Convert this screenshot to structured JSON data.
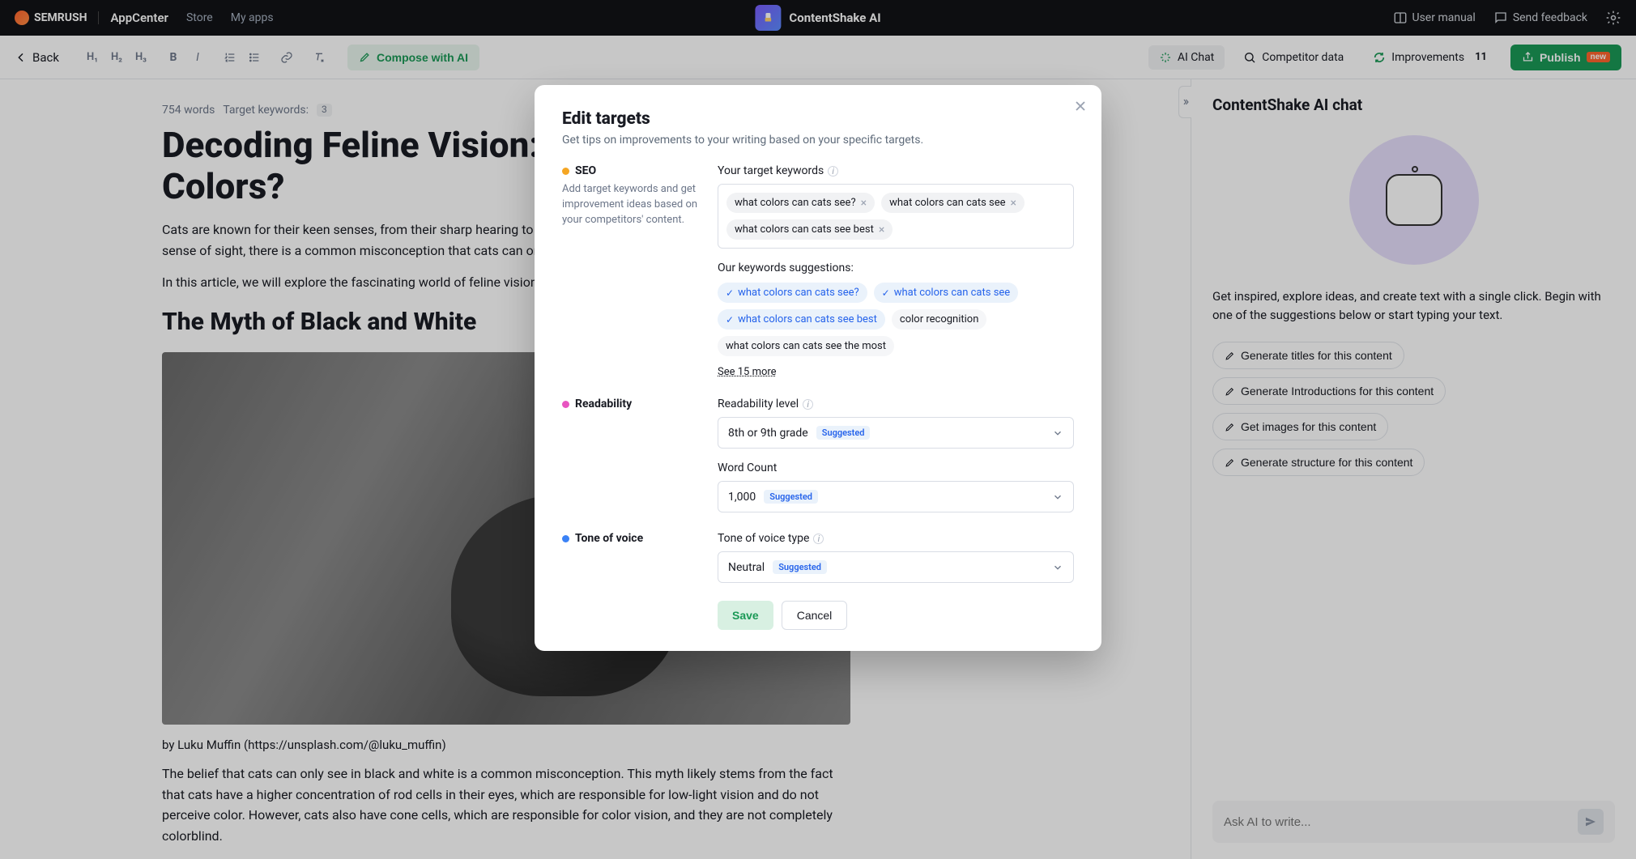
{
  "header": {
    "brand": "SEMRUSH",
    "appcenter": "AppCenter",
    "store": "Store",
    "my_apps": "My apps",
    "app_name": "ContentShake AI",
    "user_manual": "User manual",
    "send_feedback": "Send feedback"
  },
  "toolbar": {
    "back": "Back",
    "compose": "Compose with AI",
    "ai_chat": "AI Chat",
    "competitor": "Competitor data",
    "improvements": "Improvements",
    "improvements_count": "11",
    "publish": "Publish",
    "new": "new"
  },
  "editor": {
    "word_count": "754 words",
    "target_kw_label": "Target keywords:",
    "target_kw_count": "3",
    "title": "Decoding Feline Vision: What Are Cat Colors?",
    "p1": "Cats are known for their keen senses, from their sharp hearing to their acute sense of smell. But when it comes to their sense of sight, there is a common misconception that cats can only see in black and white.",
    "p2": "In this article, we will explore the fascinating world of feline vision.",
    "h2": "The Myth of Black and White",
    "caption": "by Luku Muffin (https://unsplash.com/@luku_muffin)",
    "p3": "The belief that cats can only see in black and white is a common misconception. This myth likely stems from the fact that cats have a higher concentration of rod cells in their eyes, which are responsible for low-light vision and do not perceive color. However, cats also have cone cells, which are responsible for color vision, and they are not completely colorblind."
  },
  "chat": {
    "title": "ContentShake AI chat",
    "desc": "Get inspired, explore ideas, and create text with a single click. Begin with one of the suggestions below or start typing your text.",
    "s1": "Generate titles for this content",
    "s2": "Generate Introductions for this content",
    "s3": "Get images for this content",
    "s4": "Generate structure for this content",
    "placeholder": "Ask AI to write..."
  },
  "modal": {
    "title": "Edit targets",
    "subtitle": "Get tips on improvements to your writing based on your specific targets.",
    "seo": {
      "label": "SEO",
      "desc": "Add target keywords and get improvement ideas based on your competitors' content.",
      "field_label": "Your target keywords",
      "kw1": "what colors can cats see?",
      "kw2": "what colors can cats see",
      "kw3": "what colors can cats see best",
      "sugg_label": "Our keywords suggestions:",
      "sk1": "what colors can cats see?",
      "sk2": "what colors can cats see",
      "sk3": "what colors can cats see best",
      "sk4": "color recognition",
      "sk5": "what colors can cats see the most",
      "see_more": "See 15 more"
    },
    "readability": {
      "label": "Readability",
      "field_label": "Readability level",
      "value": "8th or 9th grade",
      "wc_label": "Word Count",
      "wc_value": "1,000"
    },
    "tone": {
      "label": "Tone of voice",
      "field_label": "Tone of voice type",
      "value": "Neutral"
    },
    "suggested": "Suggested",
    "save": "Save",
    "cancel": "Cancel"
  }
}
